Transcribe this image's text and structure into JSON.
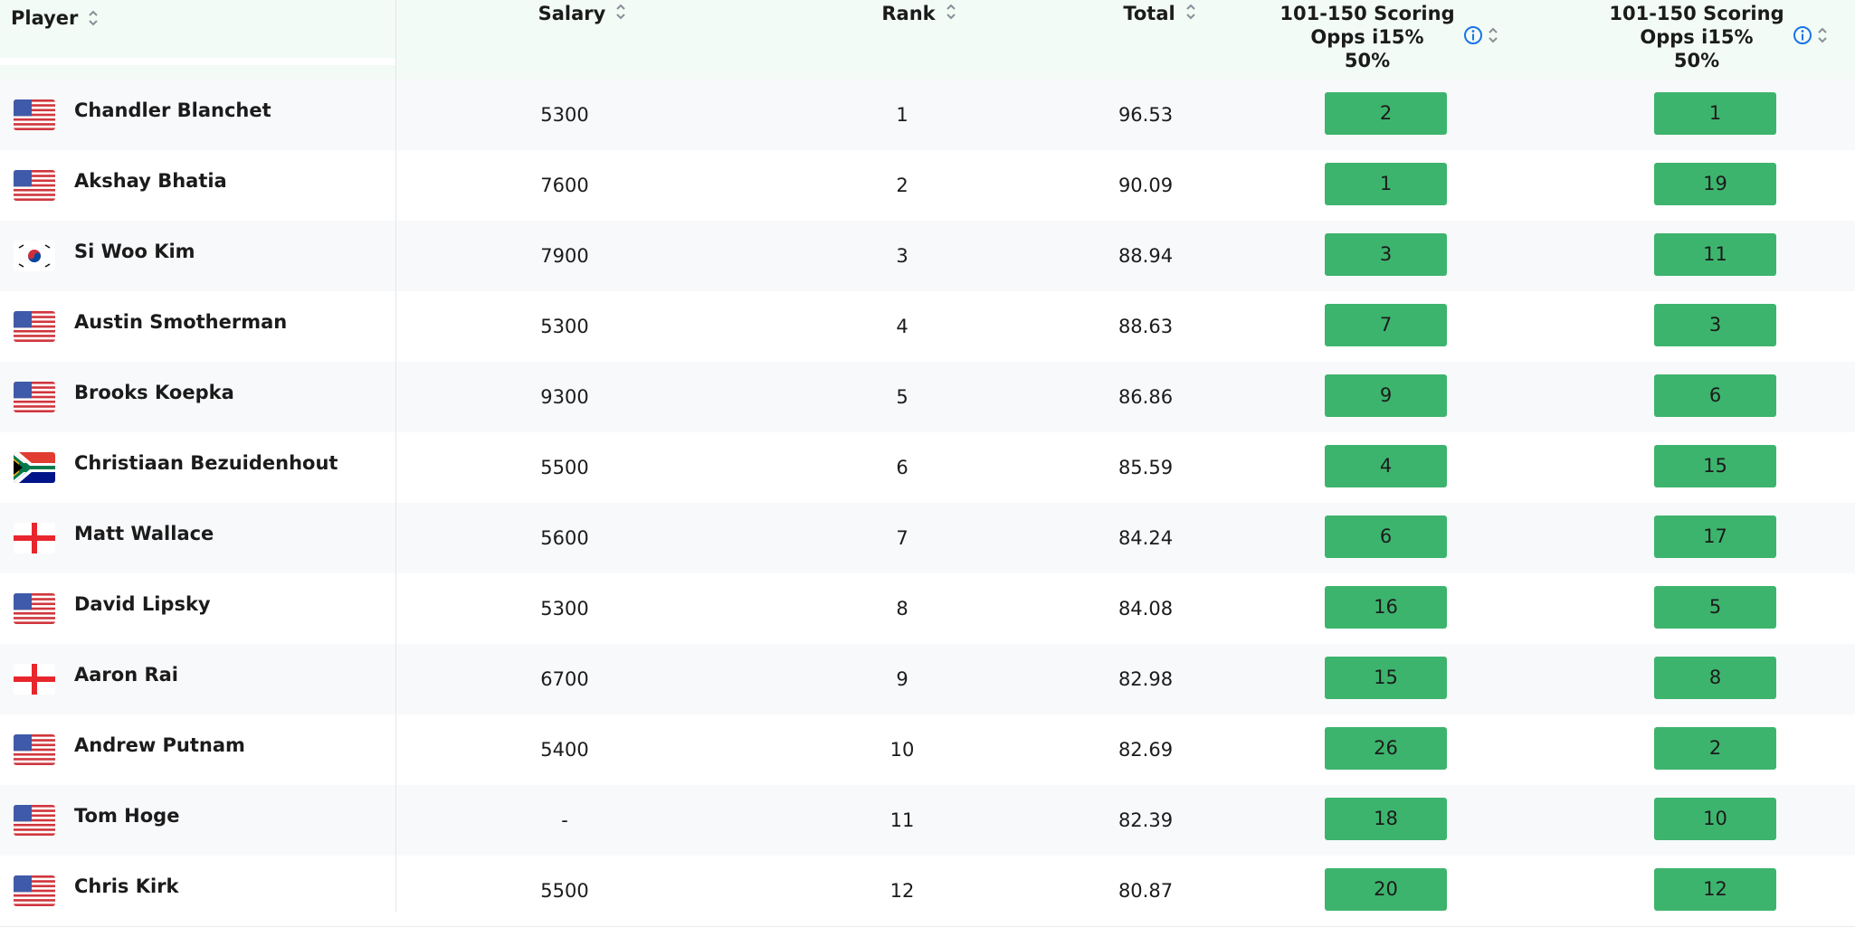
{
  "header": {
    "player": "Player",
    "salary": "Salary",
    "rank": "Rank",
    "total": "Total",
    "stat1_lines": [
      "101-150 Scoring",
      "Opps i15%",
      "50%"
    ],
    "stat2_lines": [
      "101-150 Scoring",
      "Opps i15%",
      "50%"
    ]
  },
  "colors": {
    "header_bg": "#f2fbf5",
    "pill": "#3db46d",
    "info": "#1a73e8"
  },
  "rows": [
    {
      "flag": "usa-flag-icon",
      "name": "Chandler Blanchet",
      "salary": "5300",
      "rank": "1",
      "total": "96.53",
      "s1": "2",
      "s2": "1"
    },
    {
      "flag": "usa-flag-icon",
      "name": "Akshay Bhatia",
      "salary": "7600",
      "rank": "2",
      "total": "90.09",
      "s1": "1",
      "s2": "19"
    },
    {
      "flag": "korea-flag-icon",
      "name": "Si Woo Kim",
      "salary": "7900",
      "rank": "3",
      "total": "88.94",
      "s1": "3",
      "s2": "11"
    },
    {
      "flag": "usa-flag-icon",
      "name": "Austin Smotherman",
      "salary": "5300",
      "rank": "4",
      "total": "88.63",
      "s1": "7",
      "s2": "3"
    },
    {
      "flag": "usa-flag-icon",
      "name": "Brooks Koepka",
      "salary": "9300",
      "rank": "5",
      "total": "86.86",
      "s1": "9",
      "s2": "6"
    },
    {
      "flag": "south-africa-flag-icon",
      "name": "Christiaan Bezuidenhout",
      "salary": "5500",
      "rank": "6",
      "total": "85.59",
      "s1": "4",
      "s2": "15"
    },
    {
      "flag": "england-flag-icon",
      "name": "Matt Wallace",
      "salary": "5600",
      "rank": "7",
      "total": "84.24",
      "s1": "6",
      "s2": "17"
    },
    {
      "flag": "usa-flag-icon",
      "name": "David Lipsky",
      "salary": "5300",
      "rank": "8",
      "total": "84.08",
      "s1": "16",
      "s2": "5"
    },
    {
      "flag": "england-flag-icon",
      "name": "Aaron Rai",
      "salary": "6700",
      "rank": "9",
      "total": "82.98",
      "s1": "15",
      "s2": "8"
    },
    {
      "flag": "usa-flag-icon",
      "name": "Andrew Putnam",
      "salary": "5400",
      "rank": "10",
      "total": "82.69",
      "s1": "26",
      "s2": "2"
    },
    {
      "flag": "usa-flag-icon",
      "name": "Tom Hoge",
      "salary": "-",
      "rank": "11",
      "total": "82.39",
      "s1": "18",
      "s2": "10"
    },
    {
      "flag": "usa-flag-icon",
      "name": "Chris Kirk",
      "salary": "5500",
      "rank": "12",
      "total": "80.87",
      "s1": "20",
      "s2": "12"
    }
  ]
}
